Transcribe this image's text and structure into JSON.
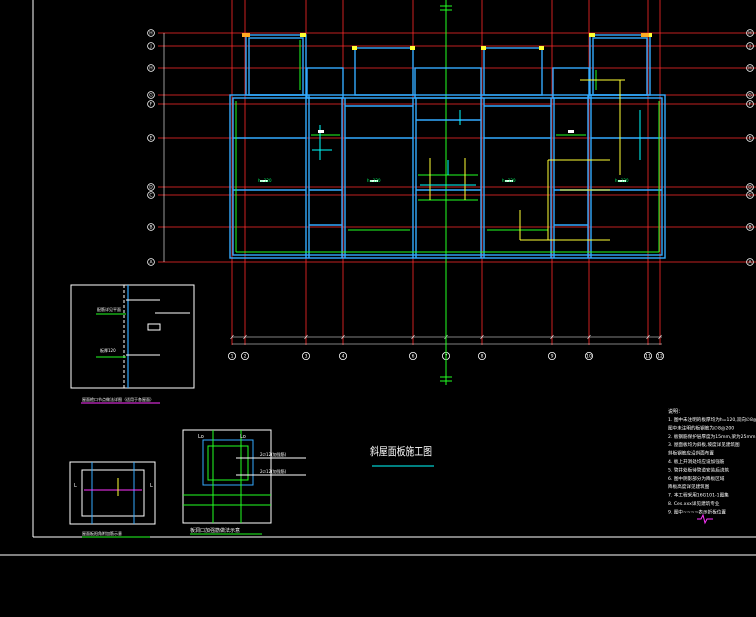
{
  "drawing": {
    "title": "斜屋面板施工图",
    "colors": {
      "background": "#000000",
      "frame": "#ffffff",
      "axis": "#ff2a2a",
      "wall": "#33aaff",
      "wall_edge": "#22ff22",
      "column": "#ffff33",
      "cyan": "#00ffff",
      "magenta": "#ff33ff",
      "text": "#ffffff",
      "orange": "#ffaa22"
    },
    "row_axes": [
      "H",
      "J",
      "H",
      "G",
      "F",
      "E",
      "D",
      "C",
      "B",
      "A"
    ],
    "column_axes": [
      "1",
      "2",
      "3",
      "4",
      "6",
      "7",
      "8",
      "9",
      "10",
      "11",
      "12"
    ],
    "room_labels": [
      "h=120",
      "h=120",
      "h=120",
      "h=120"
    ],
    "detail_1": {
      "caption": "屋面檐口节点做法详图（适用于各屋面）",
      "notes": [
        "配筋详见平面",
        "板厚120"
      ]
    },
    "detail_2": {
      "caption": "屋面板阳角附加筋示意",
      "labels": [
        "L",
        "L"
      ]
    },
    "detail_3": {
      "caption": "板洞口加强筋做法示意",
      "labels": [
        "Lo",
        "Lo",
        "2∅12(加强筋)",
        "2∅12(加强筋)"
      ]
    },
    "notes": {
      "heading": "说明：",
      "items": [
        "1. 图中未注明的板厚均为h=120,双向∅8@200",
        "   图中未注明的板钢筋为∅8@200",
        "2. 板钢筋保护层厚度为15mm,梁为25mm",
        "3. 屋面板均为斜板,坡度详见建筑图",
        "   斜板钢筋应沿斜面布置",
        "4. 板上开洞处均应设加强筋",
        "5. 管井处板待管道安装后浇筑",
        "6. 图中阴影部分为降板区域",
        "   降板高度详见建筑图",
        "7. 本工程采用16G101-1图集",
        "8. Ces.xxx详见建筑专业",
        "9. 图中~~~~表示折板位置"
      ]
    }
  }
}
